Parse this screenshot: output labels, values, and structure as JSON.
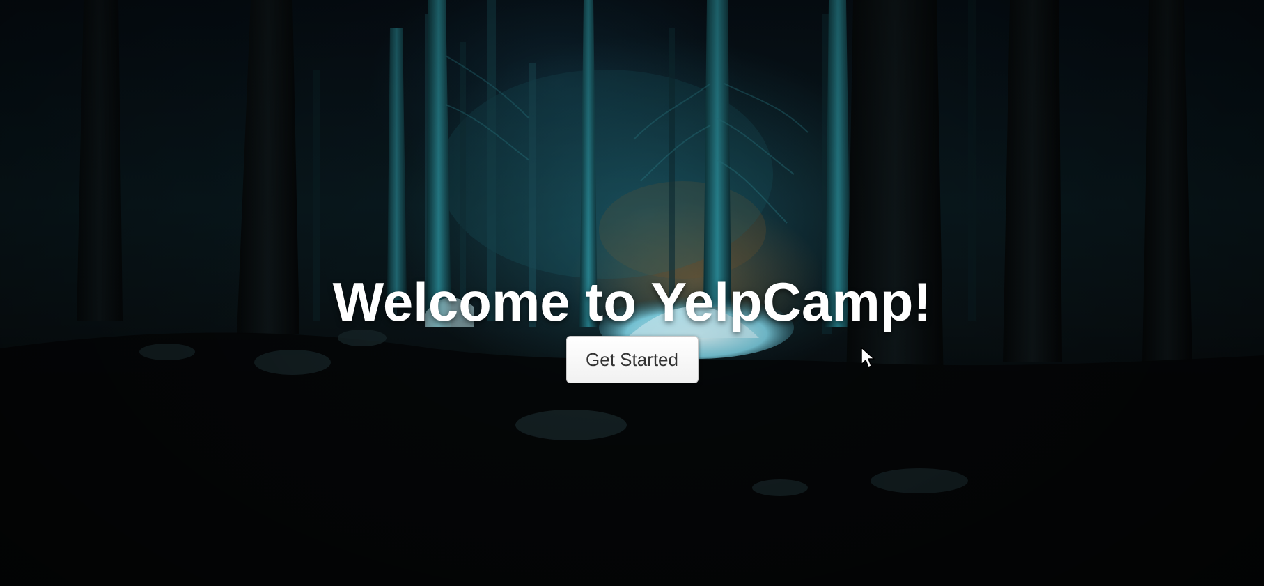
{
  "landing": {
    "title": "Welcome to YelpCamp!",
    "cta_label": "Get Started"
  },
  "colors": {
    "title_text": "#ffffff",
    "button_bg": "#ffffff",
    "button_text": "#333333",
    "night_sky": "#05080a",
    "tent_glow": "#bfe9f2"
  },
  "icons": {
    "cursor": "mouse-pointer-icon"
  }
}
